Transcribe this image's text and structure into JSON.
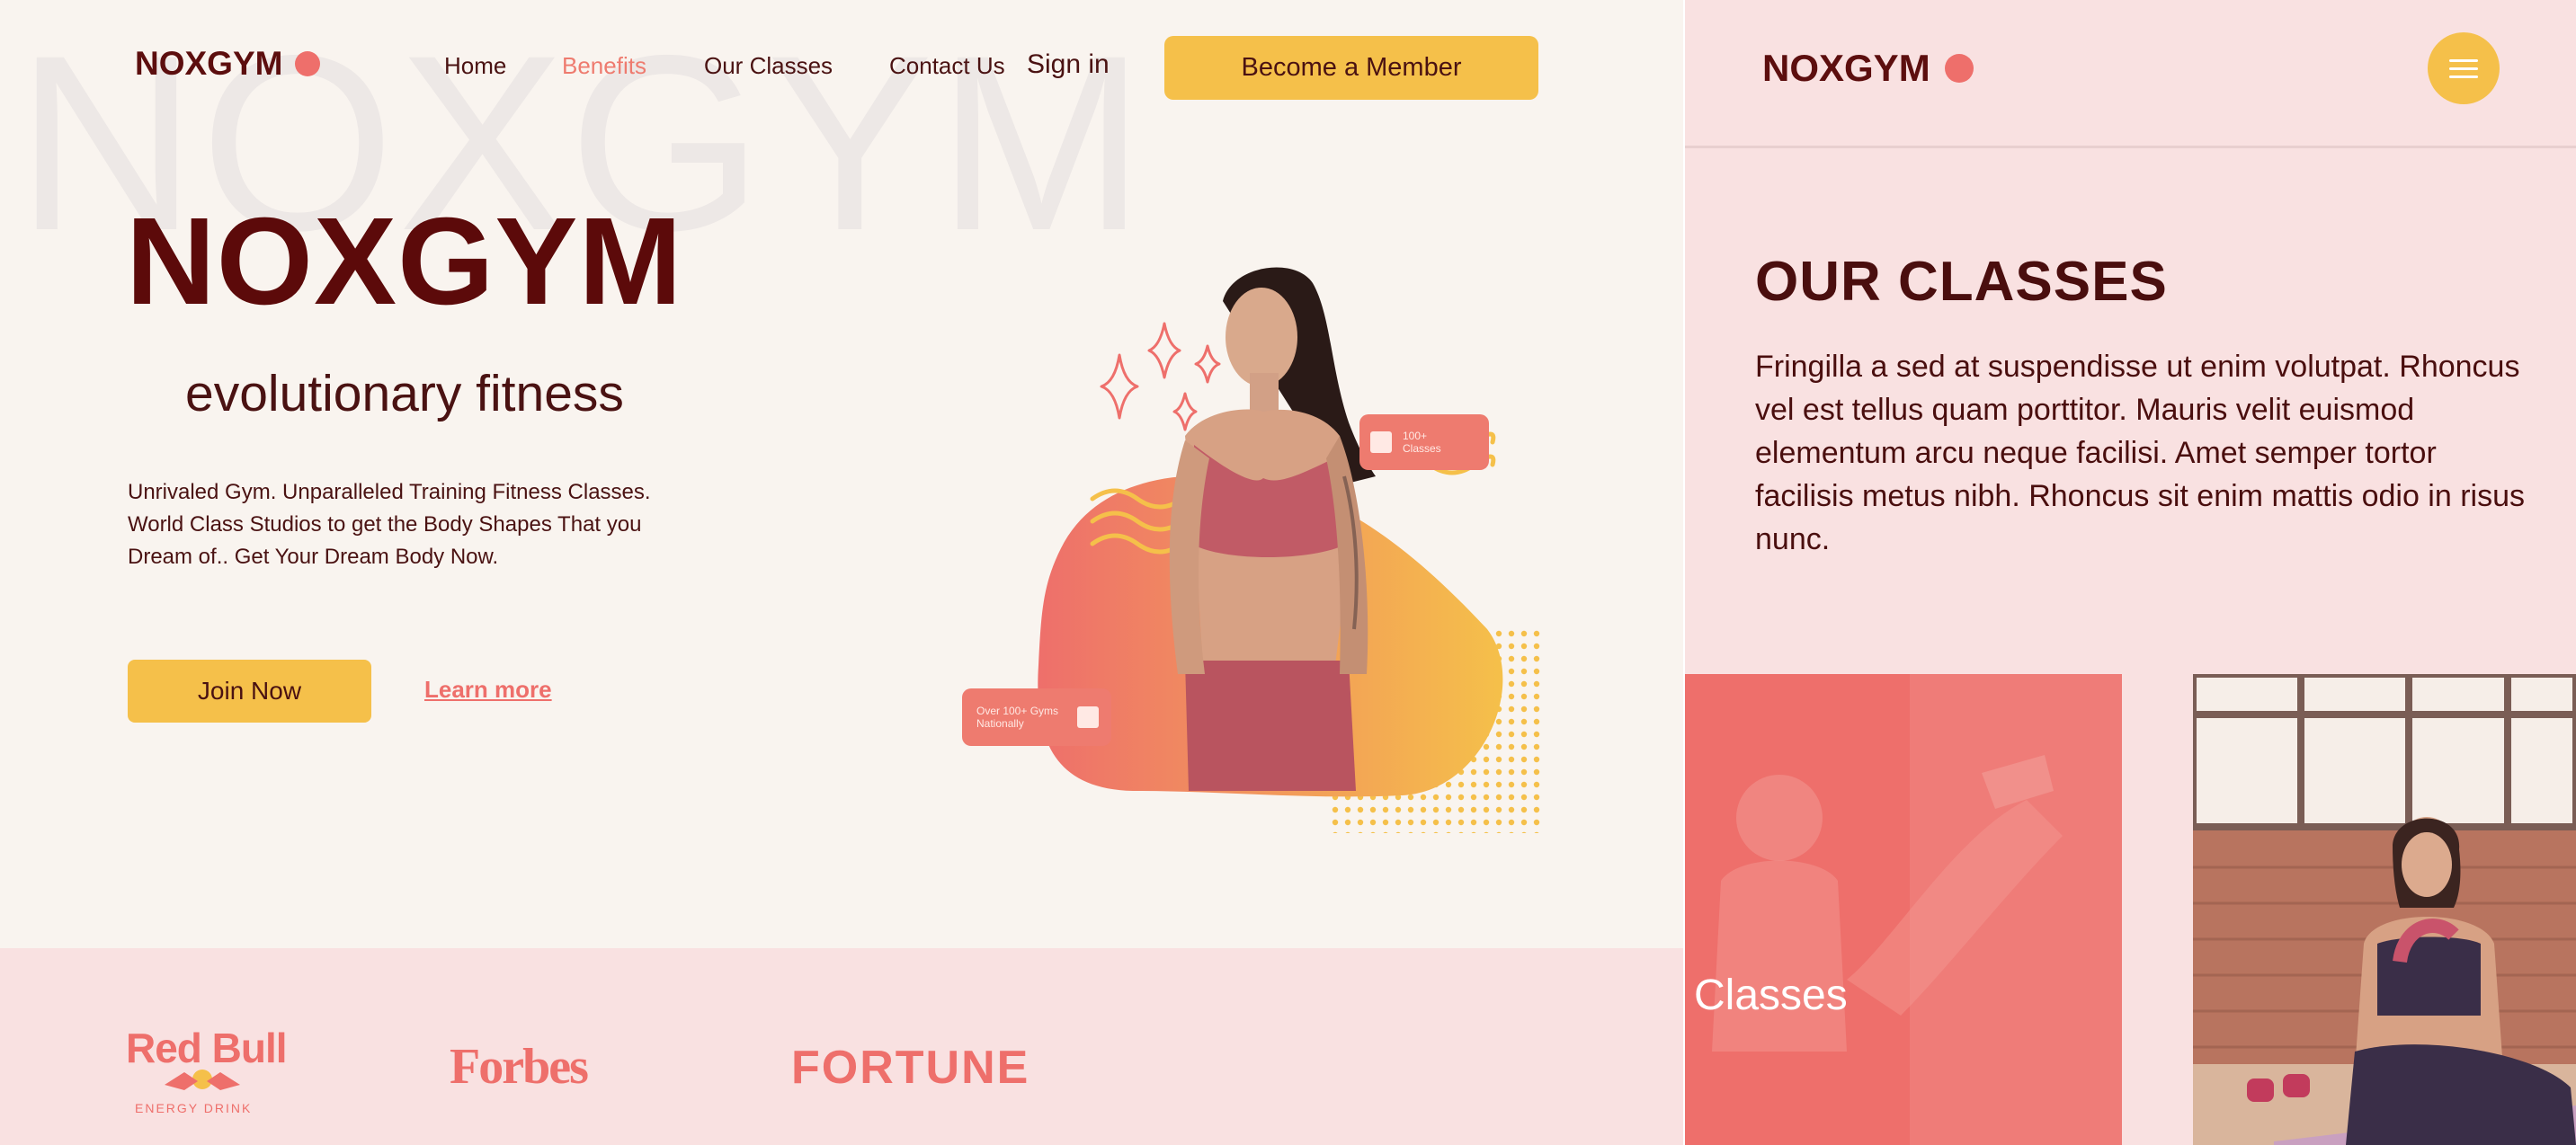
{
  "desktop": {
    "watermark": "NOXGYM",
    "nav": {
      "logo": "NOXGYM",
      "links": [
        {
          "label": "Home"
        },
        {
          "label": "Benefits",
          "active": true
        },
        {
          "label": "Our Classes"
        },
        {
          "label": "Contact Us"
        }
      ],
      "signin": "Sign in",
      "cta": "Become a Member"
    },
    "hero": {
      "title": "NOXGYM",
      "subtitle": "evolutionary fitness",
      "description": "Unrivaled Gym. Unparalleled Training Fitness Classes. World Class Studios to get the Body Shapes That you Dream of.. Get Your Dream Body Now.",
      "join_button": "Join Now",
      "learn_more": "Learn more",
      "badge_classes": "100+ Classes",
      "badge_gyms": "Over 100+ Gyms Nationally"
    },
    "brands": {
      "redbull": "Red Bull",
      "redbull_sub": "ENERGY DRINK",
      "forbes": "Forbes",
      "fortune": "FORTUNE"
    }
  },
  "mobile": {
    "logo": "NOXGYM",
    "section_title": "OUR CLASSES",
    "section_body": "Fringilla a sed at suspendisse ut enim volutpat. Rhoncus vel est tellus quam porttitor. Mauris velit euismod elementum arcu neque facilisi. Amet semper tortor facilisis metus nibh. Rhoncus sit enim mattis odio in risus nunc.",
    "card_label": "Classes"
  },
  "colors": {
    "accent_yellow": "#f5c04a",
    "accent_coral": "#ee6f6b",
    "text_dark": "#4a1212",
    "bg_cream": "#f9f4ef",
    "bg_pink": "#f9e1e1"
  }
}
